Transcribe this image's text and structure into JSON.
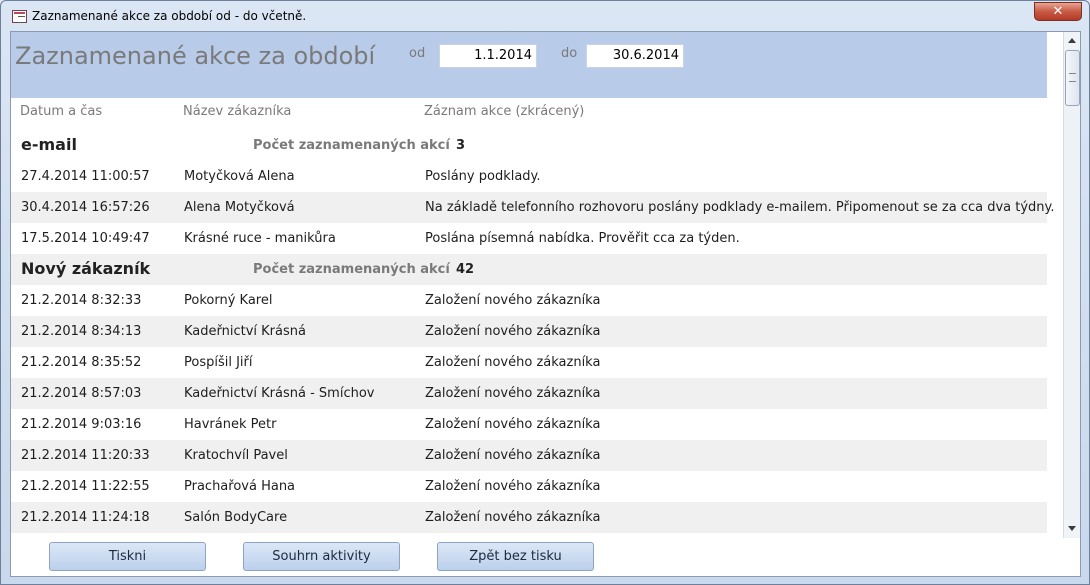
{
  "window": {
    "title": "Zaznamenané akce za období od - do včetně.",
    "close_glyph": "✕"
  },
  "header": {
    "title": "Zaznamenané akce za období",
    "from_label": "od",
    "from_value": "1.1.2014",
    "to_label": "do",
    "to_value": "30.6.2014"
  },
  "columns": {
    "datetime": "Datum a čas",
    "customer": "Název zákazníka",
    "record": "Záznam akce (zkrácený)"
  },
  "groups": [
    {
      "name": "e-mail",
      "count_label": "Počet zaznamenaných akcí",
      "count": "3",
      "rows": [
        {
          "datetime": "27.4.2014 11:00:57",
          "customer": "Motyčková Alena",
          "record": "Poslány podklady."
        },
        {
          "datetime": "30.4.2014 16:57:26",
          "customer": "Alena Motyčková",
          "record": "Na základě telefonního rozhovoru poslány podklady e-mailem. Připomenout se za cca dva týdny."
        },
        {
          "datetime": "17.5.2014 10:49:47",
          "customer": "Krásné ruce - manikůra",
          "record": "Poslána písemná nabídka. Prověřit cca za týden."
        }
      ]
    },
    {
      "name": "Nový zákazník",
      "count_label": "Počet zaznamenaných akcí",
      "count": "42",
      "rows": [
        {
          "datetime": "21.2.2014 8:32:33",
          "customer": "Pokorný Karel",
          "record": "Založení nového zákazníka"
        },
        {
          "datetime": "21.2.2014 8:34:13",
          "customer": "Kadeřnictví Krásná",
          "record": "Založení nového zákazníka"
        },
        {
          "datetime": "21.2.2014 8:35:52",
          "customer": "Pospíšil Jiří",
          "record": "Založení nového zákazníka"
        },
        {
          "datetime": "21.2.2014 8:57:03",
          "customer": "Kadeřnictví Krásná - Smíchov",
          "record": "Založení nového zákazníka"
        },
        {
          "datetime": "21.2.2014 9:03:16",
          "customer": "Havránek Petr",
          "record": "Založení nového zákazníka"
        },
        {
          "datetime": "21.2.2014 11:20:33",
          "customer": "Kratochvíl Pavel",
          "record": "Založení nového zákazníka"
        },
        {
          "datetime": "21.2.2014 11:22:55",
          "customer": "Prachařová Hana",
          "record": "Založení nového zákazníka"
        },
        {
          "datetime": "21.2.2014 11:24:18",
          "customer": "Salón BodyCare",
          "record": "Založení nového zákazníka"
        }
      ]
    }
  ],
  "footer": {
    "print_label": "Tiskni",
    "summary_label": "Souhrn aktivity",
    "back_label": "Zpět bez tisku"
  }
}
